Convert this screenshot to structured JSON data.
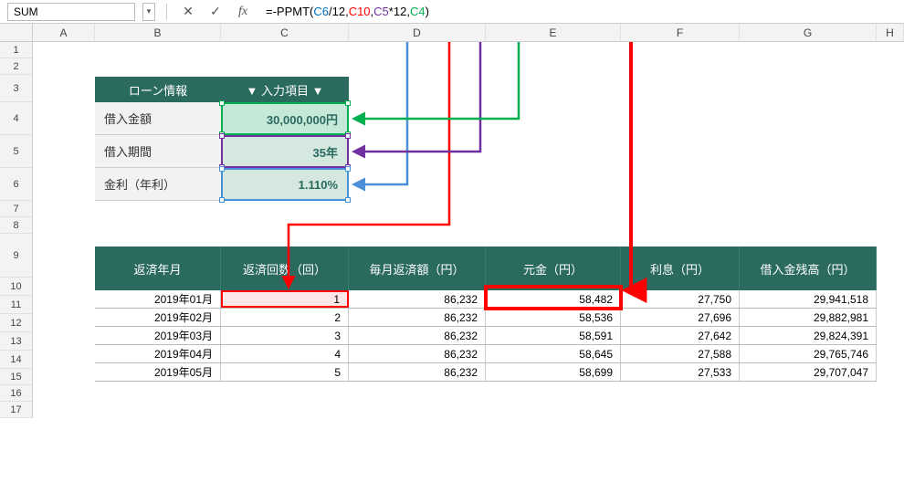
{
  "formula_bar": {
    "name_box": "SUM",
    "formula_prefix": "=-PPMT(",
    "arg1": "C6",
    "div": "/12,",
    "arg2": "C10",
    "comma1": ",",
    "arg3": "C5",
    "mul": "*12,",
    "arg4": "C4",
    "close": ")"
  },
  "columns": [
    "A",
    "B",
    "C",
    "D",
    "E",
    "F",
    "G",
    "H"
  ],
  "row_nums": [
    "1",
    "2",
    "3",
    "4",
    "5",
    "6",
    "7",
    "8",
    "9",
    "10",
    "11",
    "12",
    "13",
    "14",
    "15",
    "16",
    "17"
  ],
  "loan": {
    "header_label": "ローン情報",
    "header_input": "▼ 入力項目 ▼",
    "r1_label": "借入金額",
    "r1_val": "30,000,000円",
    "r2_label": "借入期間",
    "r2_val": "35年",
    "r3_label": "金利（年利）",
    "r3_val": "1.110%"
  },
  "table": {
    "headers": [
      "返済年月",
      "返済回数（回）",
      "毎月返済額（円）",
      "元金（円）",
      "利息（円）",
      "借入金残高（円）"
    ],
    "rows": [
      {
        "ym": "2019年01月",
        "n": "1",
        "pay": "86,232",
        "prin": "58,482",
        "int": "27,750",
        "bal": "29,941,518"
      },
      {
        "ym": "2019年02月",
        "n": "2",
        "pay": "86,232",
        "prin": "58,536",
        "int": "27,696",
        "bal": "29,882,981"
      },
      {
        "ym": "2019年03月",
        "n": "3",
        "pay": "86,232",
        "prin": "58,591",
        "int": "27,642",
        "bal": "29,824,391"
      },
      {
        "ym": "2019年04月",
        "n": "4",
        "pay": "86,232",
        "prin": "58,645",
        "int": "27,588",
        "bal": "29,765,746"
      },
      {
        "ym": "2019年05月",
        "n": "5",
        "pay": "86,232",
        "prin": "58,699",
        "int": "27,533",
        "bal": "29,707,047"
      }
    ]
  }
}
